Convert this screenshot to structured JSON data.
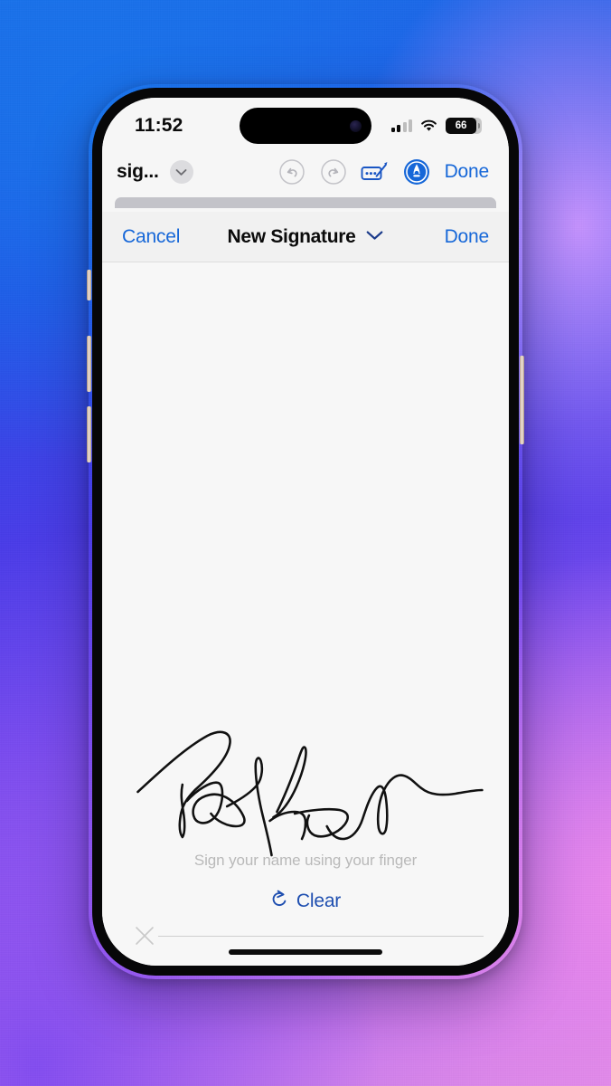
{
  "statusbar": {
    "time": "11:52",
    "battery_percent": "66",
    "cellular_icon": "signal-bars-icon",
    "wifi_icon": "wifi-icon",
    "battery_icon": "battery-icon"
  },
  "markup_toolbar": {
    "doc_title": "sig...",
    "expand_icon": "chevron-down-icon",
    "undo_icon": "undo-icon",
    "redo_icon": "redo-icon",
    "markup_icon": "markup-signature-icon",
    "pen_icon": "pen-tool-icon",
    "done_label": "Done"
  },
  "navbar": {
    "cancel_label": "Cancel",
    "title": "New Signature",
    "title_chevron_icon": "chevron-down-icon",
    "done_label": "Done"
  },
  "signature_panel": {
    "x_marker_icon": "x-mark-icon",
    "hint_text": "Sign your name using your finger",
    "clear_icon": "undo-circular-arrow-icon",
    "clear_label": "Clear",
    "has_signature": "true"
  },
  "colors": {
    "accent_blue": "#1667d8",
    "clear_blue": "#1f4fb0",
    "ink_black": "#111111",
    "hint_gray": "#b9b9b9",
    "screen_bg": "#f7f7f7",
    "navbar_bg": "#f1f1f1"
  },
  "home_indicator": "home-indicator"
}
